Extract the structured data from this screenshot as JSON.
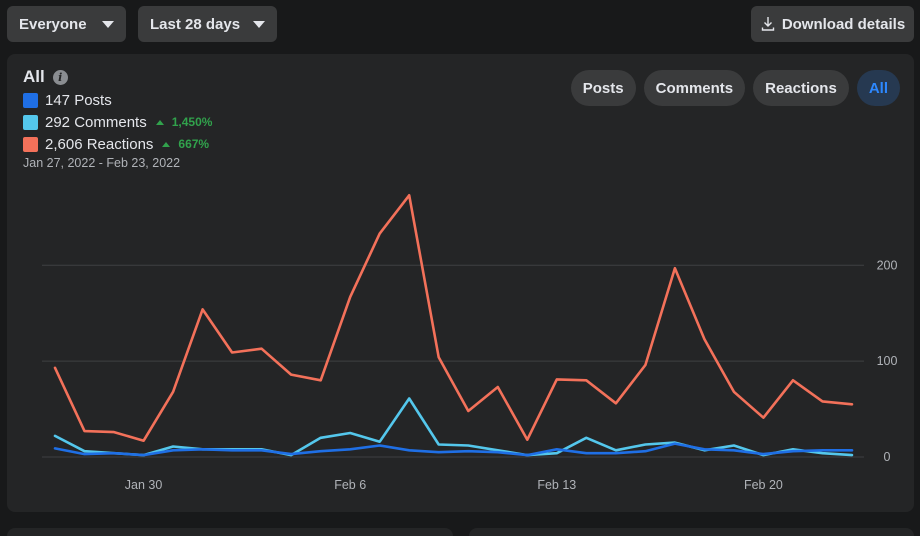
{
  "toolbar": {
    "audience": "Everyone",
    "range": "Last 28 days",
    "download": "Download details"
  },
  "card": {
    "title": "All",
    "date_range": "Jan 27, 2022 - Feb 23, 2022",
    "legend": [
      {
        "label": "147 Posts",
        "color": "#1f6fe5",
        "delta": ""
      },
      {
        "label": "292 Comments",
        "color": "#54c7ec",
        "delta": "1,450%"
      },
      {
        "label": "2,606 Reactions",
        "color": "#f3715a",
        "delta": "667%"
      }
    ],
    "filters": [
      "Posts",
      "Comments",
      "Reactions",
      "All"
    ],
    "active_filter": "All"
  },
  "chart_data": {
    "type": "line",
    "x": [
      "Jan 27",
      "Jan 28",
      "Jan 29",
      "Jan 30",
      "Jan 31",
      "Feb 1",
      "Feb 2",
      "Feb 3",
      "Feb 4",
      "Feb 5",
      "Feb 6",
      "Feb 7",
      "Feb 8",
      "Feb 9",
      "Feb 10",
      "Feb 11",
      "Feb 12",
      "Feb 13",
      "Feb 14",
      "Feb 15",
      "Feb 16",
      "Feb 17",
      "Feb 18",
      "Feb 19",
      "Feb 20",
      "Feb 21",
      "Feb 22",
      "Feb 23"
    ],
    "x_tick_labels": [
      "Jan 30",
      "Feb 6",
      "Feb 13",
      "Feb 20"
    ],
    "y_ticks": [
      0,
      100,
      200
    ],
    "ylim": [
      0,
      290
    ],
    "series": [
      {
        "name": "Reactions",
        "color": "#f3715a",
        "values": [
          93,
          27,
          26,
          17,
          68,
          154,
          109,
          113,
          86,
          80,
          167,
          233,
          273,
          104,
          48,
          73,
          18,
          81,
          80,
          56,
          96,
          197,
          123,
          68,
          41,
          80,
          58,
          55
        ]
      },
      {
        "name": "Comments",
        "color": "#54c7ec",
        "values": [
          22,
          6,
          4,
          2,
          11,
          8,
          8,
          8,
          2,
          20,
          25,
          16,
          61,
          13,
          12,
          7,
          2,
          4,
          20,
          7,
          13,
          15,
          7,
          12,
          2,
          8,
          4,
          2
        ]
      },
      {
        "name": "Posts",
        "color": "#1f6fe5",
        "values": [
          9,
          3,
          4,
          2,
          7,
          8,
          7,
          7,
          3,
          6,
          8,
          12,
          7,
          5,
          6,
          5,
          2,
          8,
          4,
          4,
          6,
          14,
          8,
          7,
          3,
          6,
          7,
          7
        ]
      }
    ]
  }
}
